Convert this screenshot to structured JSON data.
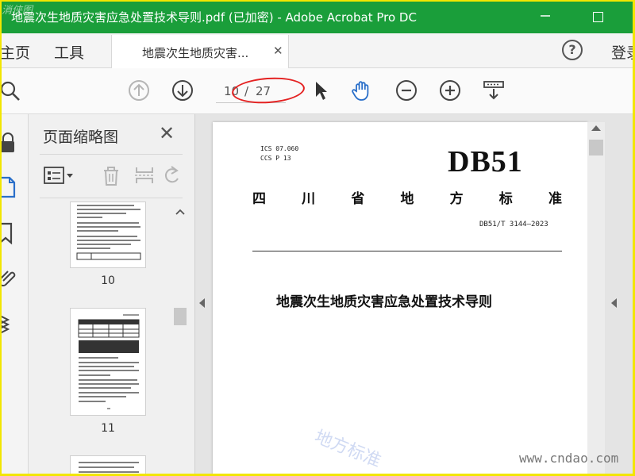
{
  "window": {
    "title": "地震次生地质灾害应急处置技术导则.pdf (已加密) - Adobe Acrobat Pro DC",
    "watermark_corner": "消侠图"
  },
  "tabs": {
    "home": "主页",
    "tools": "工具",
    "document": "地震次生地质灾害...",
    "help": "?",
    "signin": "登录"
  },
  "toolbar": {
    "current_page": "10",
    "separator": "/",
    "total_pages": "27"
  },
  "thumbnail_panel": {
    "title": "页面缩略图",
    "close": "✕",
    "pages": [
      {
        "number": "10"
      },
      {
        "number": "11"
      }
    ]
  },
  "document": {
    "ics_line1": "ICS  07.060",
    "ics_line2": "CCS  P 13",
    "standard_code": "DB51",
    "province_chars": [
      "四",
      "川",
      "省",
      "地",
      "方",
      "标",
      "准"
    ],
    "standard_number": "DB51/T 3144—2023",
    "title": "地震次生地质灾害应急处置技术导则",
    "watermark": "地方标准"
  },
  "site_watermark": "www.cndao.com",
  "colors": {
    "titlebar": "#1a9e3a",
    "annotation_ellipse": "#e42222",
    "frame": "#f2e600"
  }
}
